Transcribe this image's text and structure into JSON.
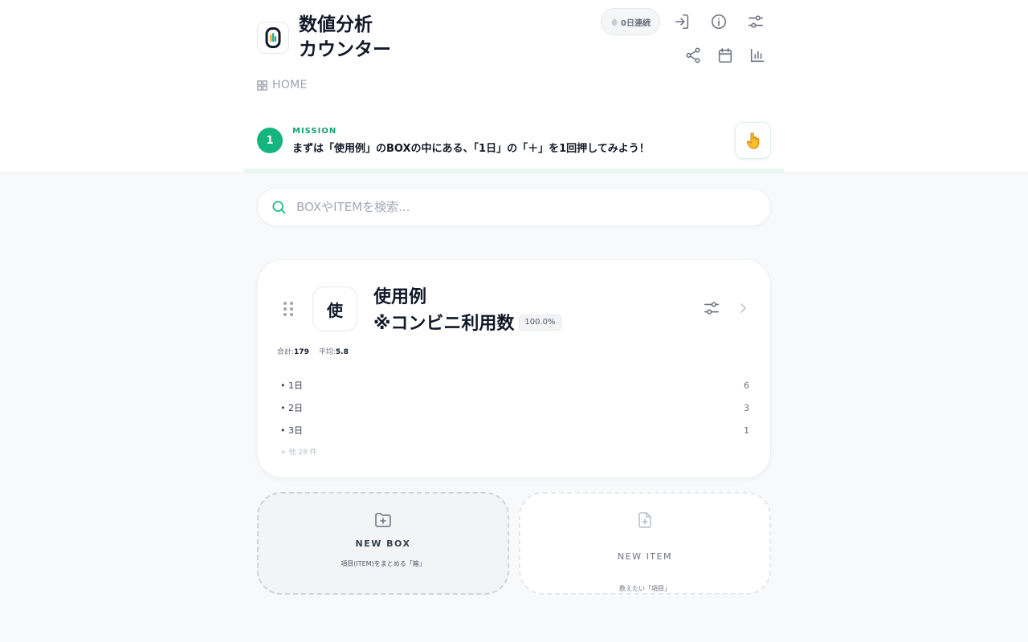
{
  "app": {
    "title_line1": "数値分析",
    "title_line2": "カウンター",
    "logo_glyph": "0",
    "logo_icon": "counter-logo-icon"
  },
  "header": {
    "streak_label": "0日連続",
    "streak_icon": "flame-icon",
    "icons": [
      "login-icon",
      "info-icon",
      "settings-sliders-icon",
      "share-icon",
      "calendar-icon",
      "bar-chart-icon"
    ]
  },
  "breadcrumb": {
    "home_label": "HOME",
    "home_icon": "grid-icon"
  },
  "mission": {
    "number": "1",
    "label": "MISSION",
    "text": "まずは「使用例」のBOXの中にある、「1日」の「＋」を1回押してみよう！",
    "action_icon": "pointing-hand-icon",
    "progress": 0,
    "accent": "#16b57e"
  },
  "search": {
    "value": "",
    "placeholder": "BOXやITEMを検索..."
  },
  "box": {
    "icon_char": "使",
    "title_line1": "使用例",
    "title_line2": "※コンビニ利用数",
    "percent": "100.0%",
    "total_label": "合計:",
    "total_value": "179",
    "avg_label": "平均:",
    "avg_value": "5.8",
    "items": [
      {
        "label": "• 1日",
        "value": "6"
      },
      {
        "label": "• 2日",
        "value": "3"
      },
      {
        "label": "• 3日",
        "value": "1"
      }
    ],
    "more_text": "+ 他 28 件"
  },
  "tiles": {
    "new_box": {
      "label": "NEW BOX",
      "sub": "項目(ITEM)をまとめる「箱」"
    },
    "new_item": {
      "label": "NEW ITEM",
      "sub": "数えたい「項目」"
    }
  }
}
